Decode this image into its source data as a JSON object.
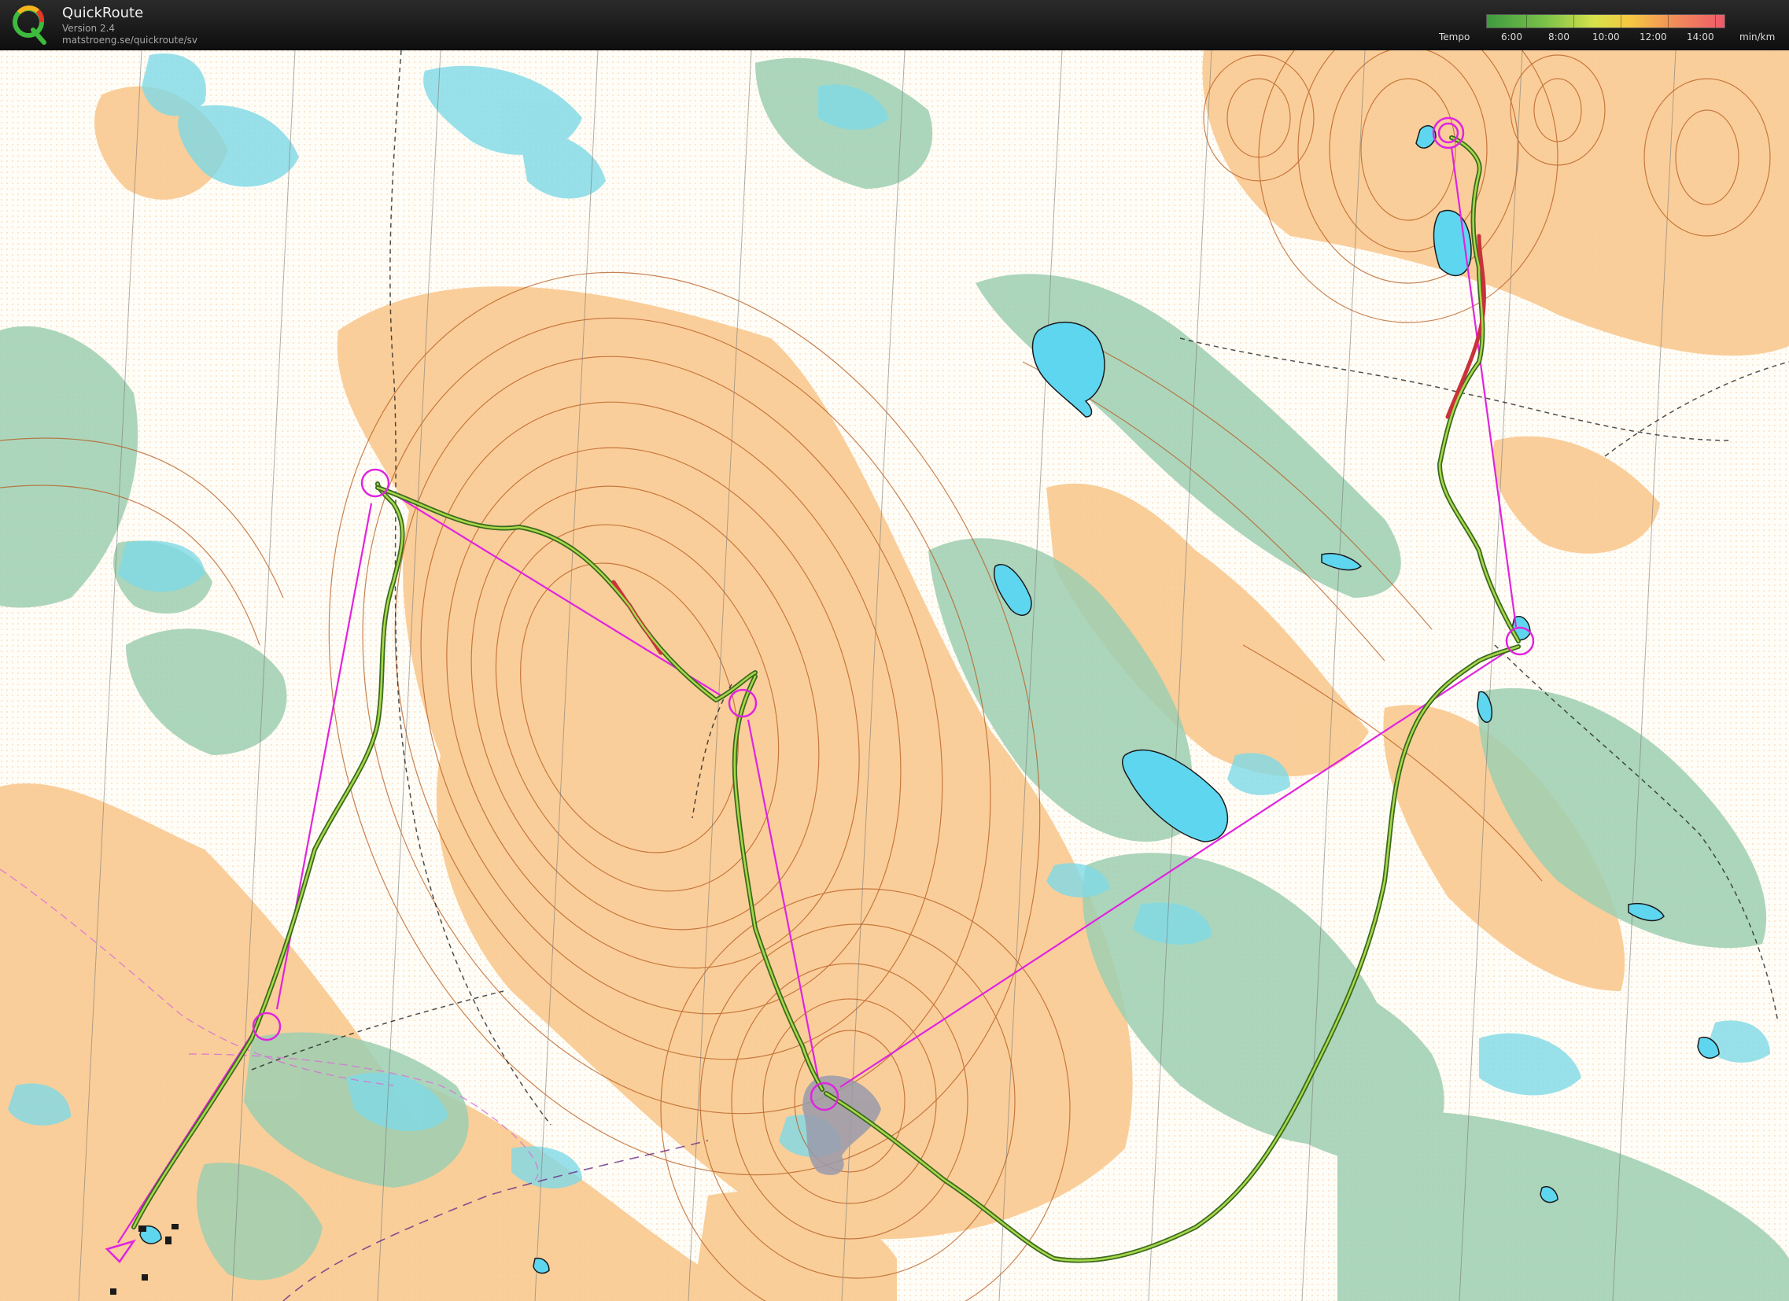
{
  "app": {
    "title": "QuickRoute",
    "version": "Version 2.4",
    "url": "matstroeng.se/quickroute/sv"
  },
  "tempo_legend": {
    "label": "Tempo",
    "ticks": [
      "6:00",
      "8:00",
      "10:00",
      "12:00",
      "14:00"
    ],
    "unit": "min/km"
  },
  "colors": {
    "course_line": "#e024e0",
    "route_fast": "#4a8a2a",
    "route_slow": "#c8323a",
    "open_land": "#f9c98f",
    "forest_green": "#9ecfb1",
    "marsh_blue": "#7fd9e6",
    "contour_brown": "#b65a1e",
    "water": "#5fd6f0"
  },
  "course": {
    "controls": 7,
    "start": "triangle",
    "legs": [
      "start-1",
      "1-2",
      "2-3",
      "3-4",
      "4-5",
      "5-6"
    ]
  }
}
